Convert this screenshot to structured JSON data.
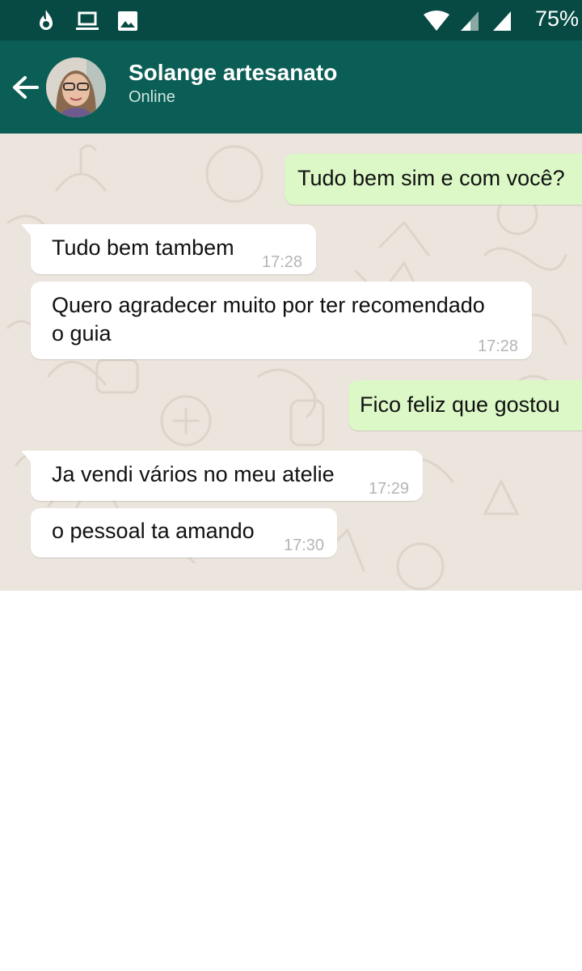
{
  "status_bar": {
    "battery_text": "75%",
    "icons": [
      "fire-notification-icon",
      "laptop-icon",
      "image-icon",
      "wifi-icon",
      "signal-icon",
      "signal-icon"
    ]
  },
  "header": {
    "contact_name": "Solange artesanato",
    "contact_status": "Online",
    "back_icon": "arrow-left-icon",
    "colors": {
      "status_bar": "#074a43",
      "app_bar": "#0b5e55"
    }
  },
  "chat": {
    "background_color": "#ece5dd",
    "messages": [
      {
        "direction": "out",
        "text": "Tudo bem sim e com você?",
        "time": ""
      },
      {
        "direction": "in",
        "text": "Tudo bem tambem",
        "time": "17:28"
      },
      {
        "direction": "in",
        "text_lines": [
          "Quero agradecer muito por ter recomendado",
          "o guia"
        ],
        "time": "17:28"
      },
      {
        "direction": "out",
        "text": "Fico feliz que gostou",
        "time": ""
      },
      {
        "direction": "in",
        "text": "Ja vendi vários no meu atelie",
        "time": "17:29"
      },
      {
        "direction": "in",
        "text": "o pessoal ta amando",
        "time": "17:30"
      }
    ],
    "bubble_colors": {
      "incoming": "#ffffff",
      "outgoing": "#dcf8c6"
    }
  }
}
